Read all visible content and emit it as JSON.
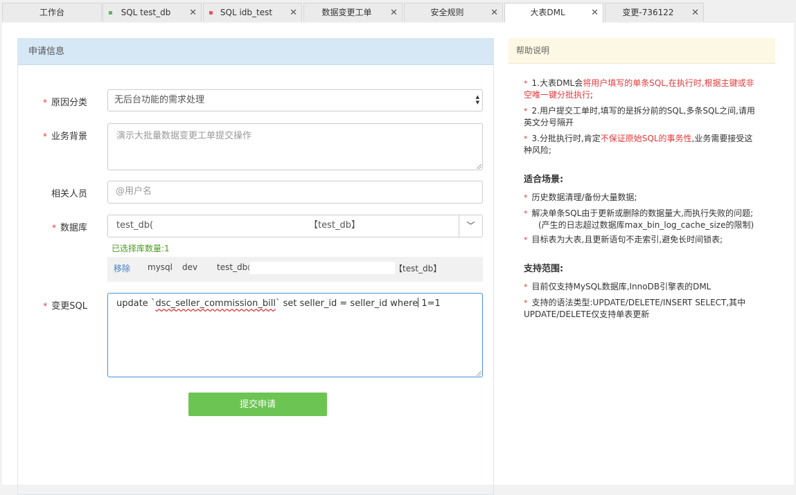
{
  "tabs": [
    {
      "label": "工作台",
      "dot": "",
      "close": false,
      "active": false
    },
    {
      "label": "SQL test_db",
      "dot": "green",
      "close": true,
      "active": false
    },
    {
      "label": "SQL idb_test",
      "dot": "red",
      "close": true,
      "active": false
    },
    {
      "label": "数据变更工单",
      "dot": "",
      "close": true,
      "active": false
    },
    {
      "label": "安全规则",
      "dot": "",
      "close": true,
      "active": false
    },
    {
      "label": "大表DML",
      "dot": "",
      "close": true,
      "active": true
    },
    {
      "label": "变更-736122",
      "dot": "",
      "close": true,
      "active": false
    }
  ],
  "form": {
    "title": "申请信息",
    "reason_label": "原因分类",
    "reason_value": "无后台功能的需求处理",
    "background_label": "业务背景",
    "background_value": "演示大批量数据变更工单提交操作",
    "people_label": "相关人员",
    "people_placeholder": "@用户名",
    "db_label": "数据库",
    "db_value_prefix": "test_db(",
    "db_value_suffix": "【test_db】",
    "selected_count": "已选择库数量:1",
    "db_row": {
      "remove": "移除",
      "type": "mysql",
      "env": "dev",
      "name_prefix": "test_db@",
      "name_suffix": "【test_db】"
    },
    "sql_label": "变更SQL",
    "sql_before": "update `",
    "sql_table": "dsc_seller_commission_bill",
    "sql_middle": "` set seller_id = seller_id where",
    "sql_after": " 1=1",
    "submit_label": "提交申请"
  },
  "help": {
    "title": "帮助说明",
    "items": [
      {
        "plain1": "1.大表DML会",
        "red": "将用户填写的单条SQL,在执行时,根据主键或非空唯一键分批执行",
        "plain2": ";"
      },
      {
        "plain1": "2.用户提交工单时,填写的是拆分前的SQL,多条SQL之间,请用英文分号隔开",
        "red": "",
        "plain2": ""
      },
      {
        "plain1": "3.分批执行时,肯定",
        "red": "不保证原始SQL的事务性",
        "plain2": ",业务需要接受这种风险;"
      }
    ],
    "scenes_title": "适合场景:",
    "scenes": [
      "历史数据清理/备份大量数据;",
      "解决单条SQL由于更新或删除的数据量大,而执行失败的问题;",
      "目标表为大表,且更新语句不走索引,避免长时间锁表;"
    ],
    "scene_note": "(产生的日志超过数据库max_bin_log_cache_size的限制)",
    "scope_title": "支持范围:",
    "scope": [
      "目前仅支持MySQL数据库,InnoDB引擎表的DML",
      "支持的语法类型:UPDATE/DELETE/INSERT SELECT,其中UPDATE/DELETE仅支持单表更新"
    ]
  }
}
